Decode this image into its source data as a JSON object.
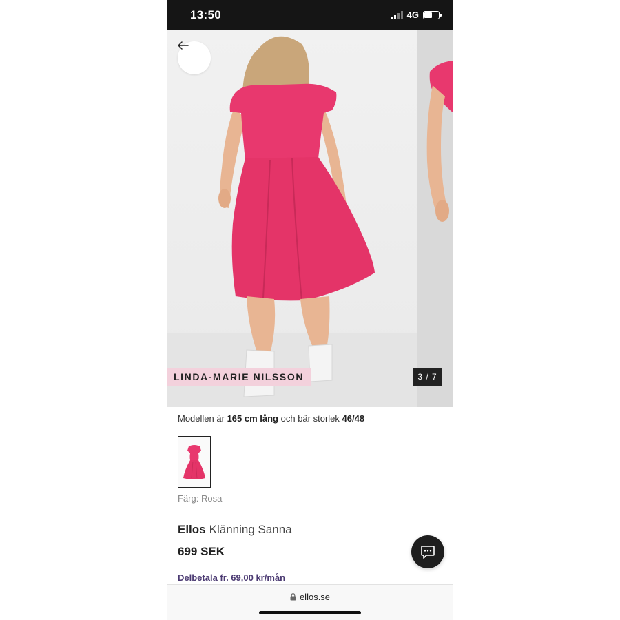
{
  "status_bar": {
    "time": "13:50",
    "network": "4G",
    "battery_level": 0.55
  },
  "gallery": {
    "model_name": "LINDA-MARIE NILSSON",
    "counter": "3 / 7",
    "current_image": 3,
    "total_images": 7,
    "back_icon": "arrow-left-icon"
  },
  "product": {
    "model_info": {
      "prefix": "Modellen är",
      "height": "165 cm lång",
      "middle": "och bär storlek",
      "size": "46/48"
    },
    "color_label": "Färg: Rosa",
    "brand": "Ellos",
    "name": "Klänning Sanna",
    "price": "699 SEK",
    "installment": "Delbetala fr. 69,00 kr/mån"
  },
  "chat": {
    "icon": "chat-bubble-icon"
  },
  "browser": {
    "url": "ellos.se",
    "lock_icon": "lock-icon"
  },
  "colors": {
    "dress_pink": "#e8386e",
    "tag_background": "#f3d1dc",
    "installment_text": "#4b3a72",
    "status_bar": "#151515"
  }
}
